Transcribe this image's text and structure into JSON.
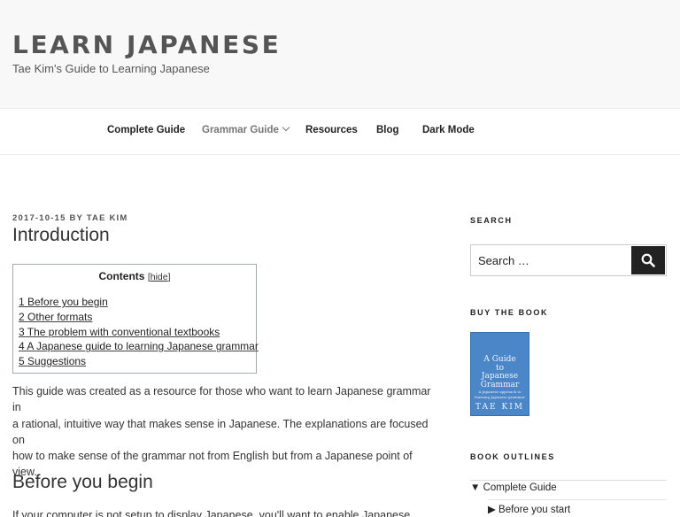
{
  "site": {
    "title": "LEARN JAPANESE",
    "description": "Tae Kim's Guide to Learning Japanese"
  },
  "nav": {
    "items": [
      {
        "label": "Complete Guide"
      },
      {
        "label": "Grammar Guide"
      },
      {
        "label": "Resources"
      },
      {
        "label": "Blog"
      },
      {
        "label": "Dark Mode"
      }
    ]
  },
  "post": {
    "date": "2017-10-15",
    "by": "BY",
    "author": "TAE KIM",
    "title": "Introduction",
    "toc": {
      "heading": "Contents",
      "hide_label": "hide",
      "items": [
        "1 Before you begin",
        "2 Other formats",
        "3 The problem with conventional textbooks",
        "4 A Japanese guide to learning Japanese grammar",
        "5 Suggestions"
      ]
    },
    "intro_lines": [
      "This guide was created as a resource for those who want to learn Japanese grammar in",
      "a rational, intuitive way that makes sense in Japanese. The explanations are focused on",
      "how to make sense of the grammar not from English but from a Japanese point of view."
    ],
    "section_heading": "Before you begin",
    "cut_paragraph": "If your computer is not setup to display Japanese, you'll want to enable Japanese"
  },
  "sidebar": {
    "search_title": "SEARCH",
    "search_placeholder": "Search …",
    "buy_title": "BUY THE BOOK",
    "book": {
      "line1": "A Guide",
      "line2": "to",
      "line3": "Japanese",
      "line4": "Grammar",
      "subtitle1": "A Japanese approach to",
      "subtitle2": "learning Japanese grammar",
      "author": "TAE KIM"
    },
    "outlines_title": "BOOK OUTLINES",
    "outline_items": [
      {
        "label": "▼ Complete Guide"
      },
      {
        "label": "▶ Before you start"
      }
    ]
  },
  "colors": {
    "header_bg": "#f8f8f8",
    "search_button": "#222222",
    "book_cover": "#4a86c8"
  },
  "icons": {
    "search_button": "search-icon",
    "grammar_guide_dropdown": "chevron-down-icon"
  }
}
